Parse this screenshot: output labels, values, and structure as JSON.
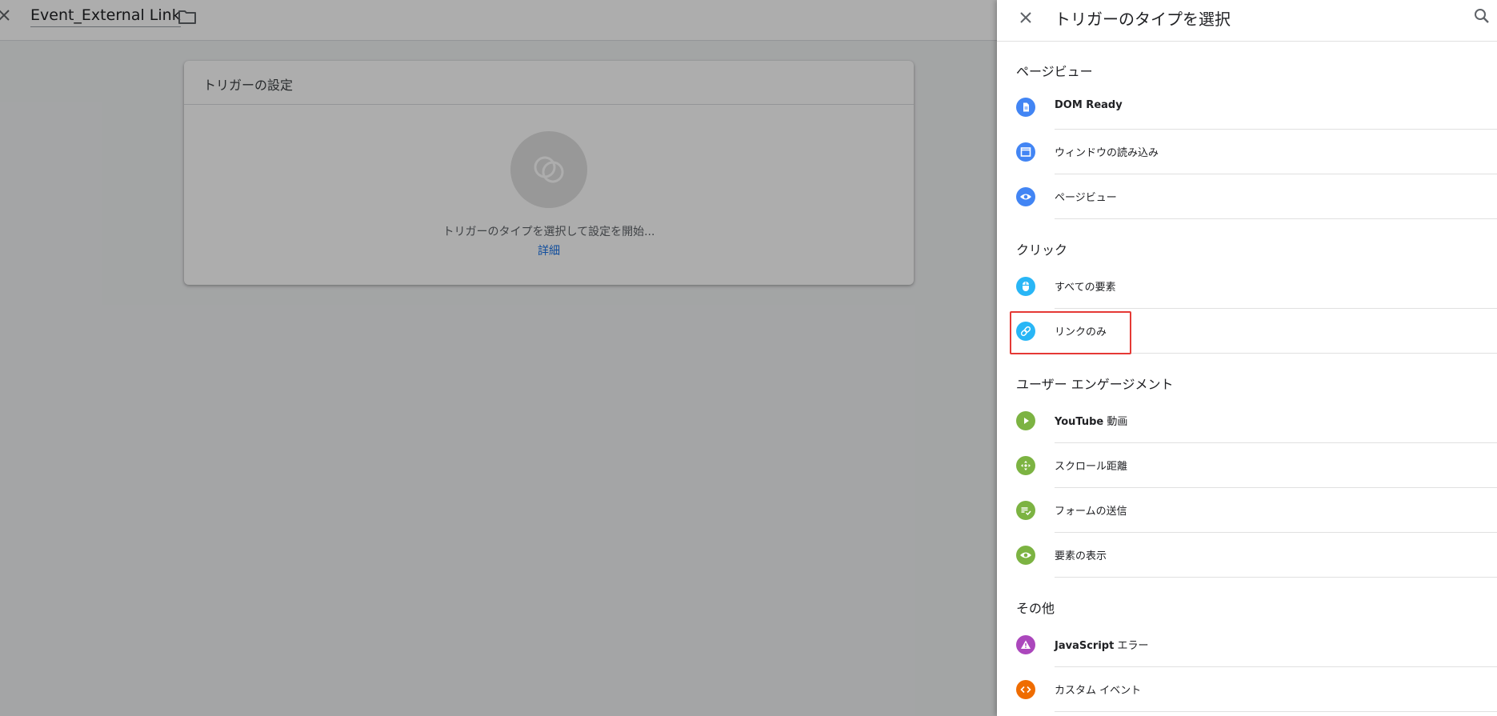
{
  "editor": {
    "trigger_name": "Event_External Link",
    "card_title": "トリガーの設定",
    "card_hint": "トリガーのタイプを選択して設定を開始...",
    "card_link": "詳細"
  },
  "panel": {
    "title": "トリガーのタイプを選択",
    "sections": [
      {
        "title": "ページビュー",
        "items": [
          {
            "bold": "DOM Ready",
            "label": "",
            "icon": "document-icon",
            "color": "#4285f4"
          },
          {
            "bold": "",
            "label": "ウィンドウの読み込み",
            "icon": "window-icon",
            "color": "#4285f4"
          },
          {
            "bold": "",
            "label": "ページビュー",
            "icon": "eye-icon",
            "color": "#4285f4"
          }
        ]
      },
      {
        "title": "クリック",
        "items": [
          {
            "bold": "",
            "label": "すべての要素",
            "icon": "mouse-icon",
            "color": "#29b6f6"
          },
          {
            "bold": "",
            "label": "リンクのみ",
            "icon": "link-icon",
            "color": "#29b6f6"
          }
        ]
      },
      {
        "title": "ユーザー エンゲージメント",
        "items": [
          {
            "bold": "YouTube",
            "label": " 動画",
            "icon": "play-icon",
            "color": "#7cb342"
          },
          {
            "bold": "",
            "label": "スクロール距離",
            "icon": "move-arrows-icon",
            "color": "#7cb342"
          },
          {
            "bold": "",
            "label": "フォームの送信",
            "icon": "form-check-icon",
            "color": "#7cb342"
          },
          {
            "bold": "",
            "label": "要素の表示",
            "icon": "eye-icon",
            "color": "#7cb342"
          }
        ]
      },
      {
        "title": "その他",
        "items": [
          {
            "bold": "JavaScript",
            "label": " エラー",
            "icon": "warning-icon",
            "color": "#ab47bc"
          },
          {
            "bold": "",
            "label": "カスタム イベント",
            "icon": "code-icon",
            "color": "#ef6c00"
          }
        ]
      }
    ]
  }
}
